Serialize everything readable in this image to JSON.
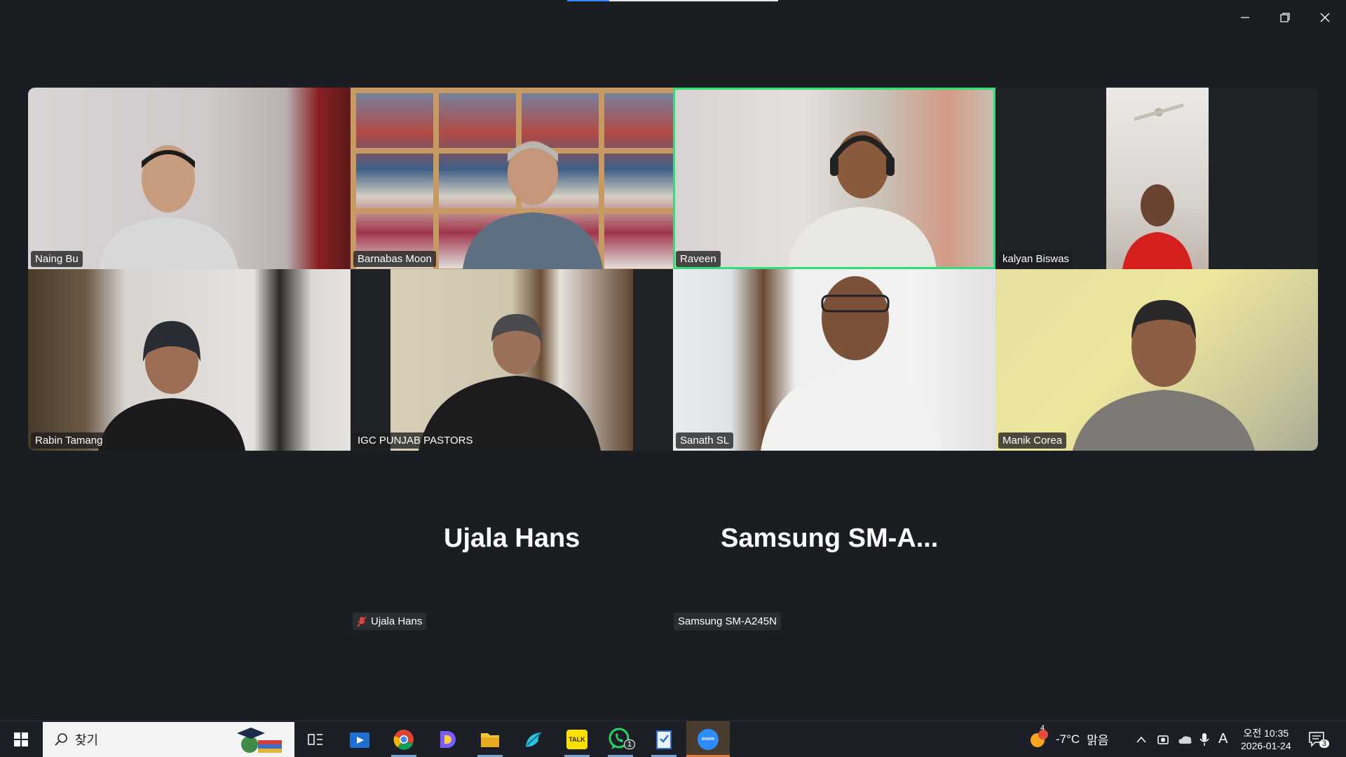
{
  "window": {
    "minimize_label": "—",
    "restore_label": "❐",
    "close_label": "✕"
  },
  "participants": [
    {
      "name": "Naing Bu"
    },
    {
      "name": "Barnabas Moon"
    },
    {
      "name": "Raveen",
      "active_speaker": true
    },
    {
      "name": "kalyan Biswas"
    },
    {
      "name": "Rabin Tamang"
    },
    {
      "name": "IGC PUNJAB PASTORS"
    },
    {
      "name": "Sanath SL"
    },
    {
      "name": "Manik Corea"
    }
  ],
  "audio_only": [
    {
      "display_name": "Ujala Hans",
      "tag": "Ujala Hans",
      "muted": true
    },
    {
      "display_name": "Samsung  SM-A...",
      "tag": "Samsung SM-A245N",
      "muted": false
    }
  ],
  "taskbar": {
    "start_icon": "windows-start-icon",
    "search_placeholder": "찾기",
    "apps": [
      {
        "name": "task-view-icon"
      },
      {
        "name": "media-player-icon"
      },
      {
        "name": "chrome-icon"
      },
      {
        "name": "d-app-icon"
      },
      {
        "name": "file-explorer-icon"
      },
      {
        "name": "bird-app-icon"
      },
      {
        "name": "kakaotalk-icon",
        "label": "TALK"
      },
      {
        "name": "whatsapp-icon",
        "badge": "1"
      },
      {
        "name": "notepad-app-icon"
      },
      {
        "name": "zoom-icon",
        "label": "zoom",
        "active": true
      }
    ],
    "weather": {
      "temp": "-7°C",
      "condition": "맑음",
      "badge": "4"
    },
    "ime": "A",
    "time": "오전 10:35",
    "date": "2026-01-24",
    "notifications": "3"
  }
}
